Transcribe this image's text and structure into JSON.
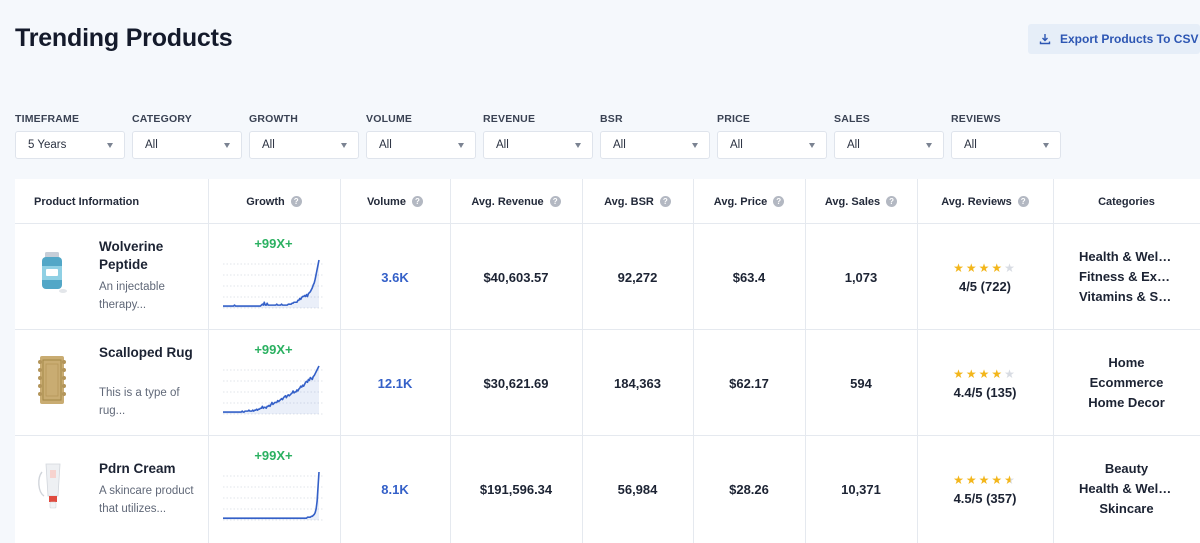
{
  "title": "Trending Products",
  "export_label": "Export Products To CSV",
  "filters": [
    {
      "label": "TIMEFRAME",
      "value": "5 Years"
    },
    {
      "label": "CATEGORY",
      "value": "All"
    },
    {
      "label": "GROWTH",
      "value": "All"
    },
    {
      "label": "VOLUME",
      "value": "All"
    },
    {
      "label": "REVENUE",
      "value": "All"
    },
    {
      "label": "BSR",
      "value": "All"
    },
    {
      "label": "PRICE",
      "value": "All"
    },
    {
      "label": "SALES",
      "value": "All"
    },
    {
      "label": "REVIEWS",
      "value": "All"
    }
  ],
  "columns": [
    "Product Information",
    "Growth",
    "Volume",
    "Avg. Revenue",
    "Avg. BSR",
    "Avg. Price",
    "Avg. Sales",
    "Avg. Reviews",
    "Categories"
  ],
  "help_glyph": "?",
  "products": [
    {
      "name": "Wolverine Peptide",
      "description": "An injectable therapy...",
      "growth": "+99X+",
      "volume": "3.6K",
      "revenue": "$40,603.57",
      "bsr": "92,272",
      "price": "$63.4",
      "sales": "1,073",
      "rating": 4,
      "reviews": "4/5 (722)",
      "categories": [
        "Health & Wellness",
        "Fitness & Exercise",
        "Vitamins & Supplements"
      ],
      "sparkline": [
        2,
        2,
        2,
        2,
        2,
        2,
        2,
        2,
        2,
        2,
        2,
        2,
        3,
        2,
        2,
        2,
        2,
        2,
        2,
        2,
        2,
        2,
        2,
        2,
        2,
        2,
        2,
        2,
        2,
        2,
        2,
        2,
        2,
        2,
        2,
        2,
        2,
        2,
        2,
        2,
        3,
        4,
        3,
        6,
        3,
        3,
        5,
        3,
        3,
        3,
        3,
        3,
        3,
        3,
        3,
        3,
        4,
        3,
        3,
        3,
        3,
        4,
        3,
        3,
        3,
        3,
        3,
        3,
        4,
        4,
        4,
        4,
        5,
        5,
        6,
        6,
        6,
        6,
        8,
        8,
        10,
        9,
        11,
        12,
        12,
        13,
        12,
        14,
        12,
        15,
        16,
        17,
        19,
        21,
        24,
        26,
        30,
        35,
        40,
        45,
        50
      ]
    },
    {
      "name": "Scalloped Rug",
      "description": "This is a type of rug...",
      "growth": "+99X+",
      "volume": "12.1K",
      "revenue": "$30,621.69",
      "bsr": "184,363",
      "price": "$62.17",
      "sales": "594",
      "rating": 4,
      "reviews": "4.4/5 (135)",
      "categories": [
        "Home",
        "Ecommerce",
        "Home Decor"
      ],
      "sparkline": [
        2,
        2,
        2,
        2,
        2,
        2,
        2,
        2,
        2,
        2,
        2,
        2,
        2,
        2,
        2,
        2,
        2,
        2,
        2,
        2,
        3,
        2,
        2,
        3,
        3,
        3,
        3,
        4,
        3,
        3,
        3,
        4,
        3,
        4,
        4,
        5,
        4,
        5,
        5,
        6,
        6,
        8,
        6,
        7,
        7,
        6,
        8,
        8,
        9,
        8,
        10,
        12,
        10,
        11,
        12,
        12,
        12,
        14,
        13,
        14,
        15,
        16,
        15,
        17,
        18,
        19,
        17,
        19,
        20,
        19,
        20,
        21,
        22,
        24,
        22,
        23,
        23,
        25,
        24,
        26,
        27,
        29,
        28,
        30,
        29,
        31,
        33,
        34,
        33,
        36,
        35,
        38,
        37,
        36,
        39,
        40,
        42,
        44,
        46,
        48,
        50
      ]
    },
    {
      "name": "Pdrn Cream",
      "description": "A skincare product that utilizes...",
      "growth": "+99X+",
      "volume": "8.1K",
      "revenue": "$191,596.34",
      "bsr": "56,984",
      "price": "$28.26",
      "sales": "10,371",
      "rating": 4.5,
      "reviews": "4.5/5 (357)",
      "categories": [
        "Beauty",
        "Health & Wellness",
        "Skincare"
      ],
      "sparkline": [
        2,
        2,
        2,
        2,
        2,
        2,
        2,
        2,
        2,
        2,
        2,
        2,
        2,
        2,
        2,
        2,
        2,
        2,
        2,
        2,
        2,
        2,
        2,
        2,
        2,
        2,
        2,
        2,
        2,
        2,
        2,
        2,
        2,
        2,
        2,
        2,
        2,
        2,
        2,
        2,
        2,
        2,
        2,
        2,
        2,
        2,
        2,
        2,
        2,
        2,
        2,
        2,
        2,
        2,
        2,
        2,
        2,
        2,
        2,
        2,
        2,
        2,
        2,
        2,
        2,
        2,
        2,
        2,
        2,
        2,
        2,
        2,
        2,
        2,
        2,
        2,
        2,
        2,
        2,
        2,
        2,
        2,
        2,
        2,
        2,
        2,
        2,
        2,
        3,
        3,
        3,
        3,
        4,
        4,
        5,
        6,
        8,
        12,
        20,
        36,
        52
      ]
    }
  ],
  "colors": {
    "accent": "#3460c8",
    "growth": "#2bb161",
    "star": "#f3b61b"
  }
}
